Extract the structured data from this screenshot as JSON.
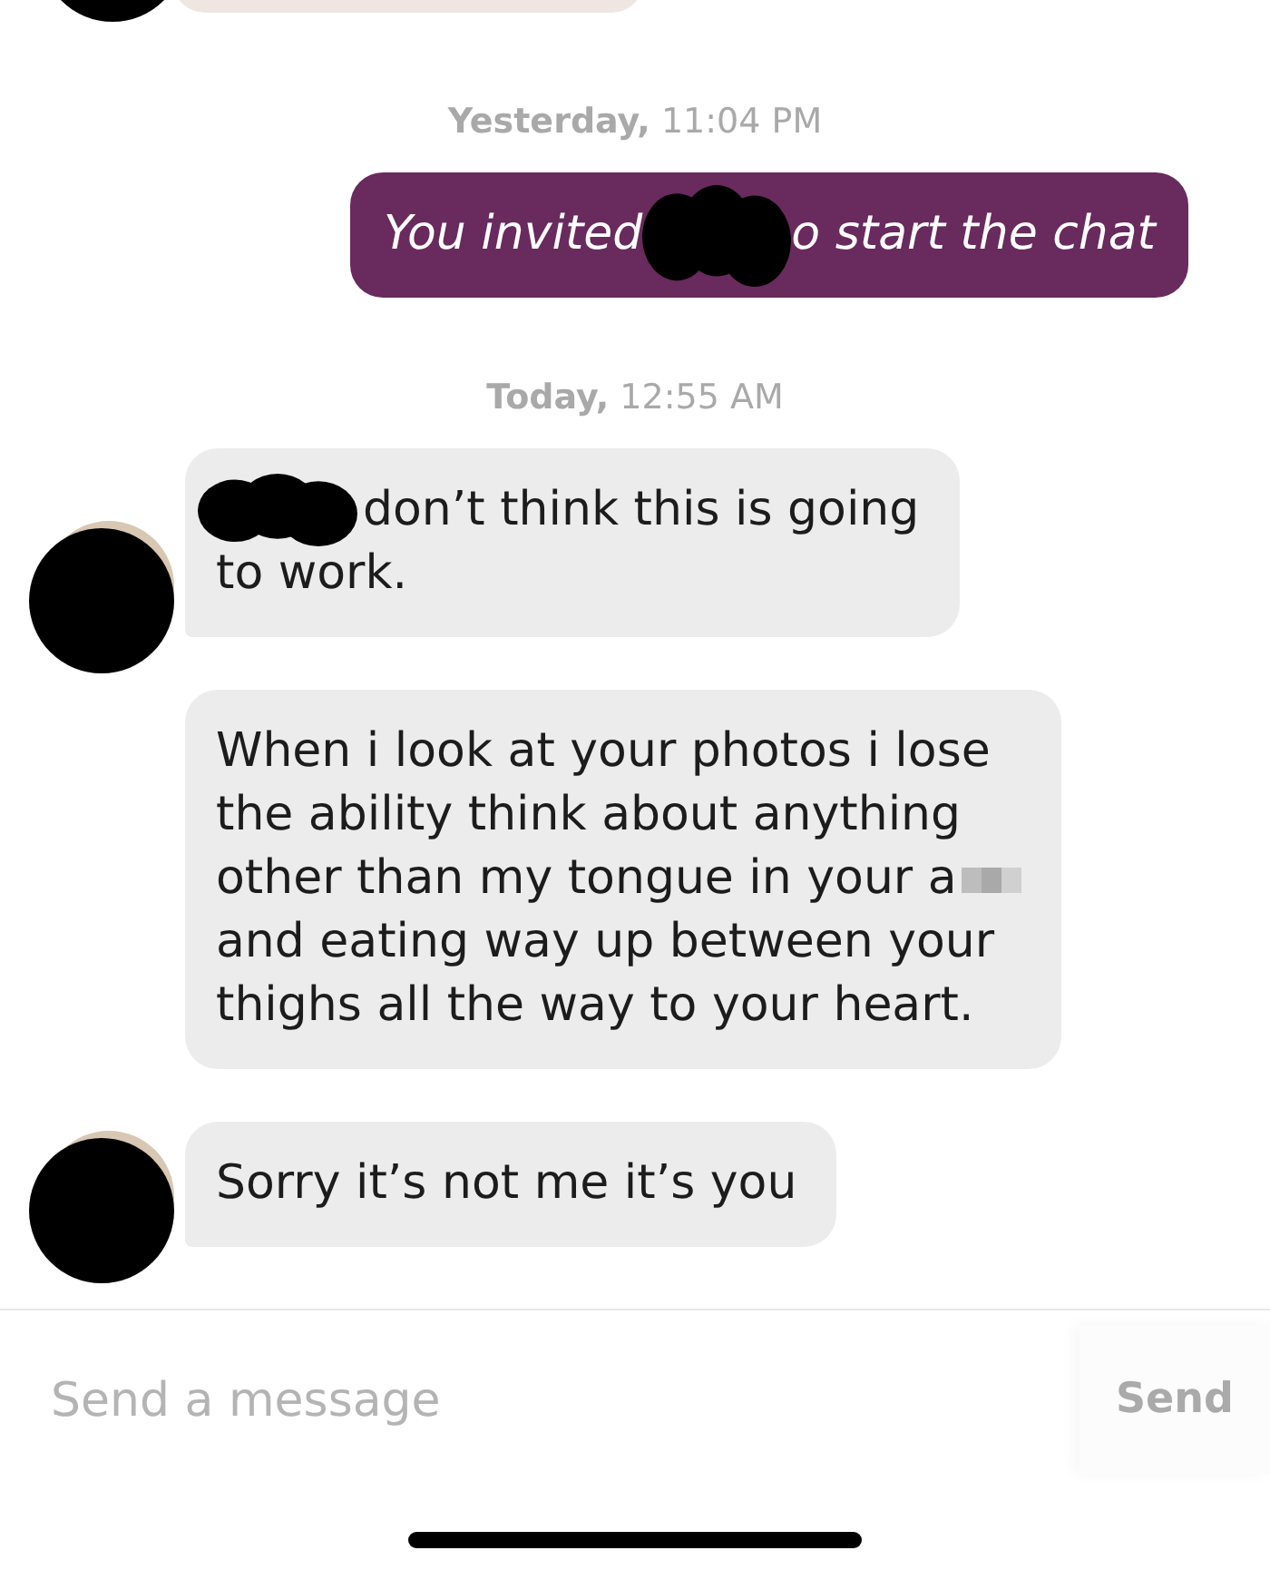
{
  "messages": [
    {
      "kind": "cut_bubble",
      "avatar": true
    },
    {
      "kind": "timestamp",
      "text": "**Yesterday,** 11:04 PM"
    },
    {
      "kind": "outgoing",
      "rows": [
        {
          "parts": [
            {
              "kind": "text",
              "text": "You invited"
            },
            {
              "kind": "redaction"
            },
            {
              "kind": "text",
              "text": "o start the chat"
            }
          ]
        }
      ]
    },
    {
      "kind": "timestamp",
      "text": "**Today,** 12:55 AM"
    },
    {
      "kind": "incoming",
      "avatar": true,
      "rows": [
        {
          "parts": [
            {
              "kind": "redaction"
            },
            {
              "kind": "text",
              "text": "don’t think this is going"
            }
          ]
        },
        {
          "parts": [
            {
              "kind": "text",
              "text": "to work."
            }
          ]
        }
      ]
    },
    {
      "kind": "incoming",
      "avatar": false,
      "rows": [
        {
          "parts": [
            {
              "kind": "text",
              "text": "When i look at your photos i lose\nthe ability think about anything"
            }
          ]
        },
        {
          "parts": [
            {
              "kind": "text",
              "text": "other than my tongue in your a"
            },
            {
              "kind": "pixelation"
            }
          ]
        },
        {
          "parts": [
            {
              "kind": "text",
              "text": "and eating way up between your\nthighs all the way to your heart."
            }
          ]
        }
      ]
    },
    {
      "kind": "incoming",
      "avatar": true,
      "rows": [
        {
          "parts": [
            {
              "kind": "text",
              "text": "Sorry it’s not me it’s you"
            }
          ]
        }
      ]
    }
  ],
  "composer": {
    "placeholder": "Send a message",
    "send_label": "Send",
    "send_disabled": true
  }
}
